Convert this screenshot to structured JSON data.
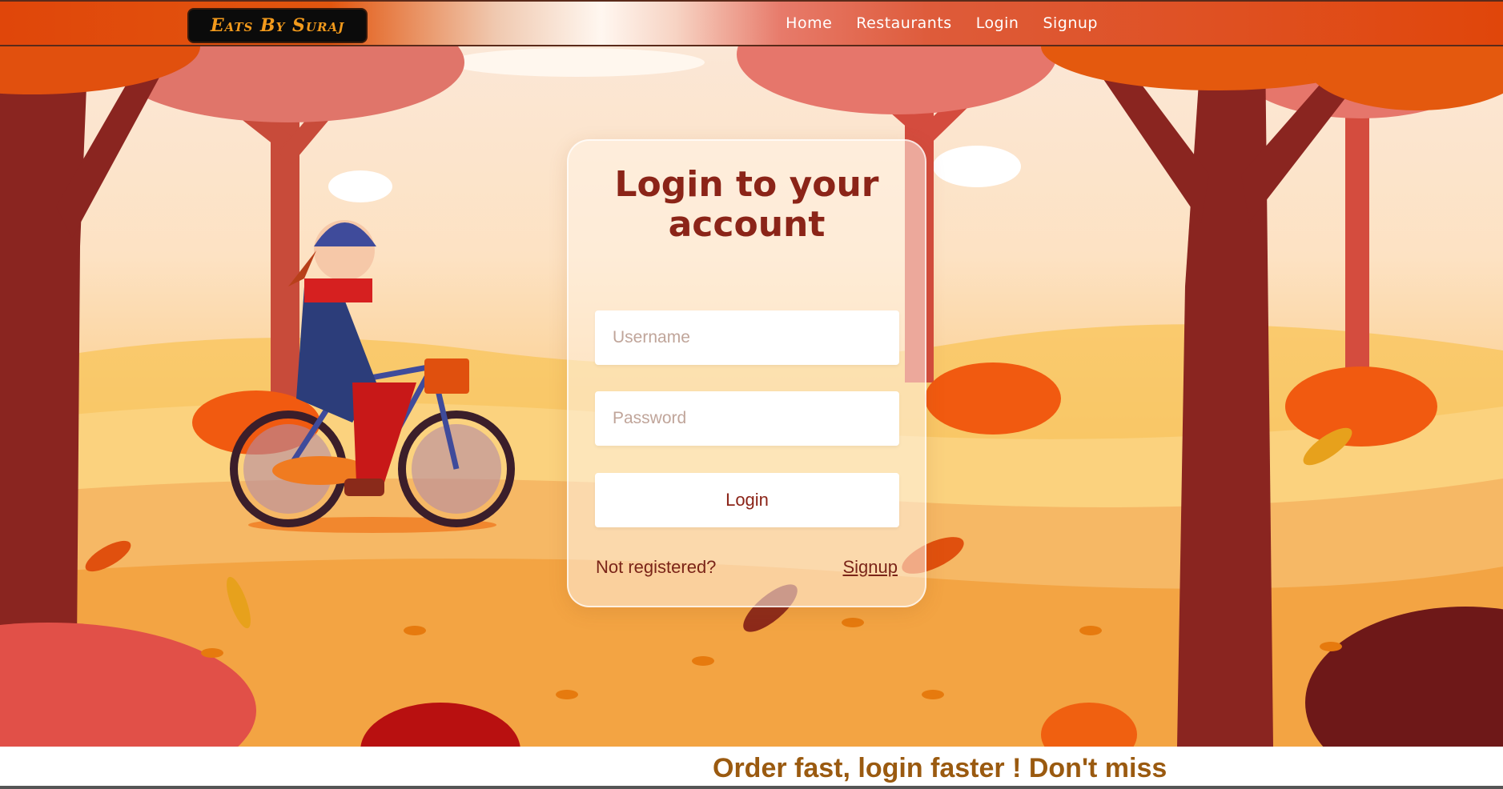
{
  "nav": {
    "brand": "Eats By Suraj",
    "links": [
      "Home",
      "Restaurants",
      "Login",
      "Signup"
    ]
  },
  "login": {
    "title": "Login to your account",
    "username_placeholder": "Username",
    "password_placeholder": "Password",
    "button_label": "Login",
    "not_registered": "Not registered?",
    "signup_label": "Signup"
  },
  "banner": {
    "text": "Order fast, login faster ! Don't miss"
  },
  "colors": {
    "nav_accent": "#e0460a",
    "title": "#8b2418",
    "banner_text": "#9a5a10"
  },
  "icons": [
    "autumn-scene-illustration",
    "cyclist-illustration",
    "leaf-icon"
  ]
}
